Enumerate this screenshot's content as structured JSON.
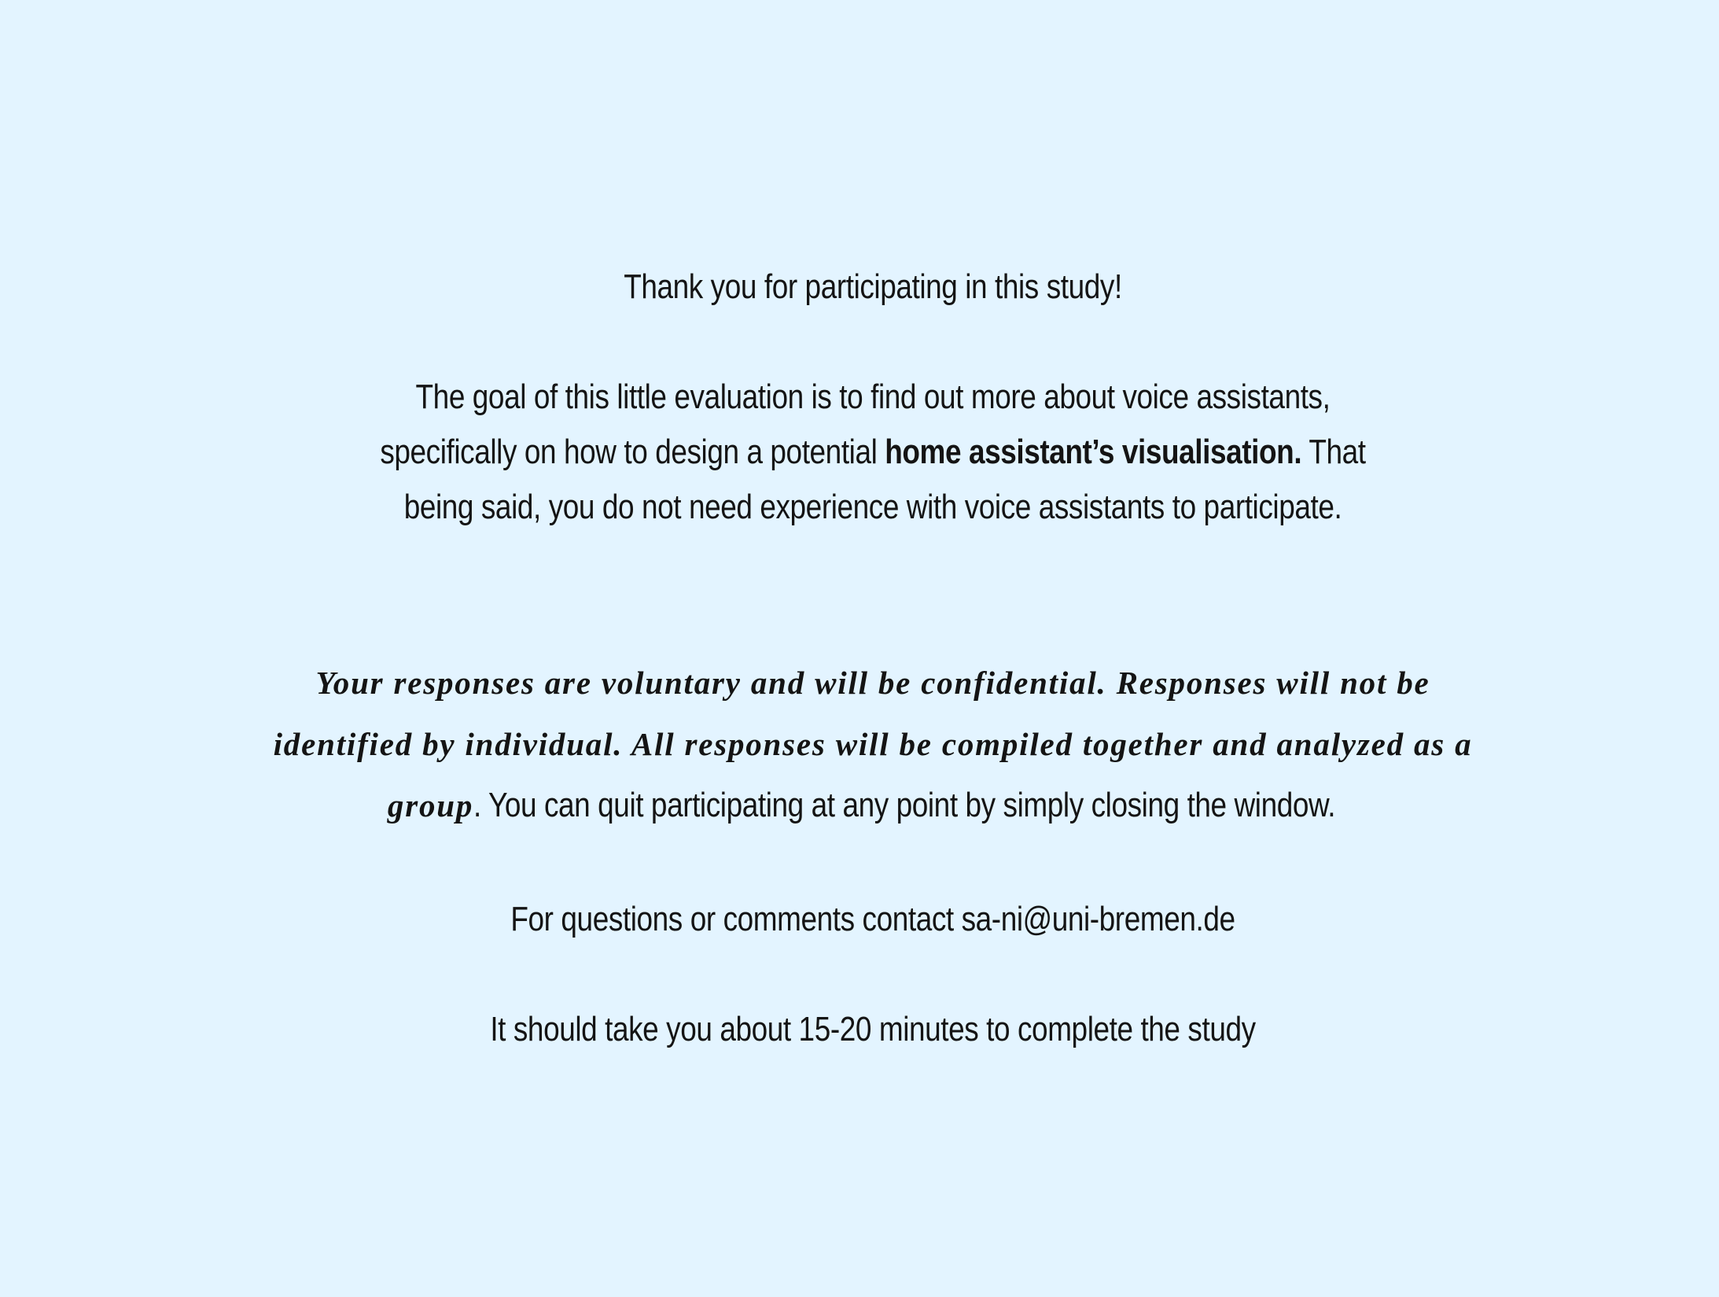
{
  "intro": {
    "thanks": "Thank you for participating in this study!",
    "goal_part1": "The goal of this little evaluation is to find out more about voice assistants, specifically on how to design a potential ",
    "goal_bold": "home assistant’s visualisation.",
    "goal_part2": " That being said, you do not need experience with voice assistants to participate."
  },
  "confidentiality": {
    "emphasis": "Your responses are voluntary and will be confidential. Responses will not be identified by individual. All responses will be compiled together and analyzed as a group",
    "tail": ". You can quit participating at any point by simply closing the window."
  },
  "contact": {
    "text": "For questions or comments contact sa-ni@uni-bremen.de"
  },
  "duration": {
    "text": "It should take you about 15-20 minutes to complete the study"
  }
}
